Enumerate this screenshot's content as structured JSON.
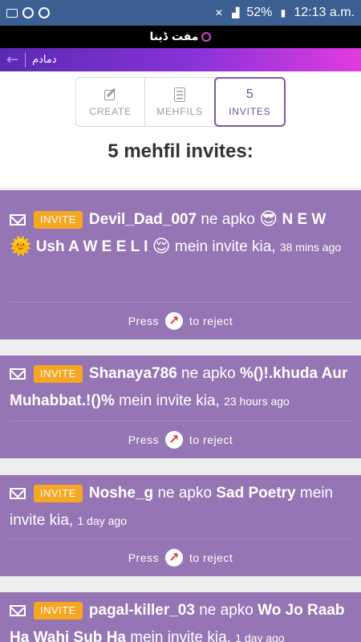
{
  "status": {
    "battery": "52%",
    "time": "12:13 a.m."
  },
  "app": {
    "title": "مفت ڈینا",
    "header": "دمادم"
  },
  "tabs": [
    {
      "label": "CREATE",
      "num": ""
    },
    {
      "label": "MEHFILS",
      "num": ""
    },
    {
      "label": "INVITES",
      "num": "5"
    }
  ],
  "page": {
    "title": "5 mehfil invites:"
  },
  "invites": [
    {
      "badge": "INVITE",
      "user": "Devil_Dad_007",
      "mid": "ne apko",
      "mehfil_a": "N E W",
      "mehfil_b": "Ush A W E E L I",
      "tail": "mein invite kia,",
      "time": "38 mins ago",
      "reject_pre": "Press",
      "reject_post": "to reject"
    },
    {
      "badge": "INVITE",
      "user": "Shanaya786",
      "mid": "ne apko",
      "mehfil": "%()!.khuda Aur Muhabbat.!()%",
      "tail": "mein invite kia,",
      "time": "23 hours ago",
      "reject_pre": "Press",
      "reject_post": "to reject"
    },
    {
      "badge": "INVITE",
      "user": "Noshe_g",
      "mid": "ne apko",
      "mehfil": "Sad Poetry",
      "tail": "mein invite kia,",
      "time": "1 day ago",
      "reject_pre": "Press",
      "reject_post": "to reject"
    },
    {
      "badge": "INVITE",
      "user": "pagal-killer_03",
      "mid": "ne apko",
      "mehfil": "Wo Jo Raab Ha Wahi Sub Ha",
      "tail": "mein invite kia,",
      "time": "1 day ago"
    }
  ]
}
